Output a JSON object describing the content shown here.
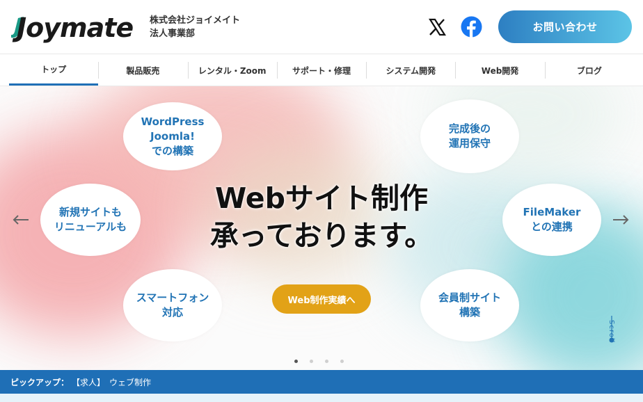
{
  "header": {
    "logo_text": "Joymate",
    "company_line1": "株式会社ジョイメイト",
    "company_line2": "法人事業部",
    "contact_label": "お問い合わせ"
  },
  "nav": {
    "items": [
      {
        "label": "トップ"
      },
      {
        "label": "製品販売"
      },
      {
        "label": "レンタル・Zoom"
      },
      {
        "label": "サポート・修理"
      },
      {
        "label": "システム開発"
      },
      {
        "label": "Web開発"
      },
      {
        "label": "ブログ"
      }
    ]
  },
  "hero": {
    "headline": "Webサイト制作\n承っております。",
    "cta_label": "Web制作実績へ",
    "circles": [
      {
        "label": "WordPress\nJoomla!\nでの構築"
      },
      {
        "label": "完成後の\n運用保守"
      },
      {
        "label": "新規サイトも\nリニューアルも"
      },
      {
        "label": "FileMaker\nとの連携"
      },
      {
        "label": "スマートフォン\n対応"
      },
      {
        "label": "会員制サイト\n構築"
      }
    ],
    "scroll_label": "Scroll",
    "active_slide": 1,
    "slide_count": 4
  },
  "pickup": {
    "label": "ピックアップ：",
    "text": "【求人】　ウェブ制作"
  },
  "icons": {
    "x": "x-logo-icon",
    "facebook": "facebook-icon",
    "prev": "arrow-left-icon",
    "next": "arrow-right-icon"
  },
  "colors": {
    "brand_blue": "#1f6fb6",
    "circle_text": "#2274b5",
    "cta": "#e2a217",
    "facebook": "#1877f2"
  }
}
